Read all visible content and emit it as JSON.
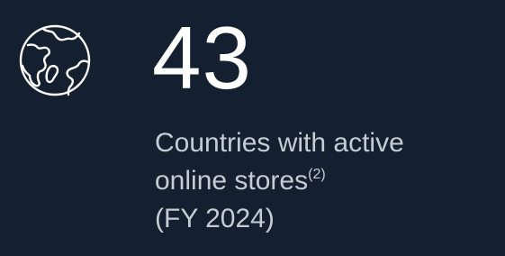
{
  "stat": {
    "value": "43",
    "line1": "Countries with active",
    "line2": "online stores",
    "footnote": "(2)",
    "line3": "(FY 2024)"
  },
  "icon": "globe-icon",
  "colors": {
    "background": "#14202f",
    "value_text": "#ffffff",
    "description_text": "#c6ccd4",
    "icon_stroke": "#ffffff"
  }
}
